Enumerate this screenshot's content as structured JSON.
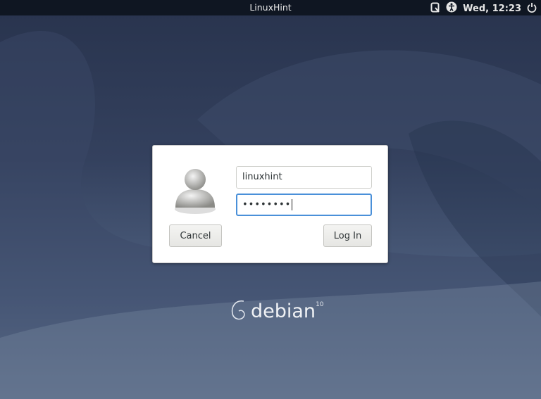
{
  "topbar": {
    "title": "LinuxHint",
    "clock": "Wed, 12:23"
  },
  "login": {
    "username": "linuxhint",
    "password_mask": "••••••••",
    "cancel_label": "Cancel",
    "login_label": "Log In"
  },
  "branding": {
    "name": "debian",
    "version": "10"
  },
  "colors": {
    "focus": "#4a90d9",
    "topbar": "#0f1622"
  }
}
